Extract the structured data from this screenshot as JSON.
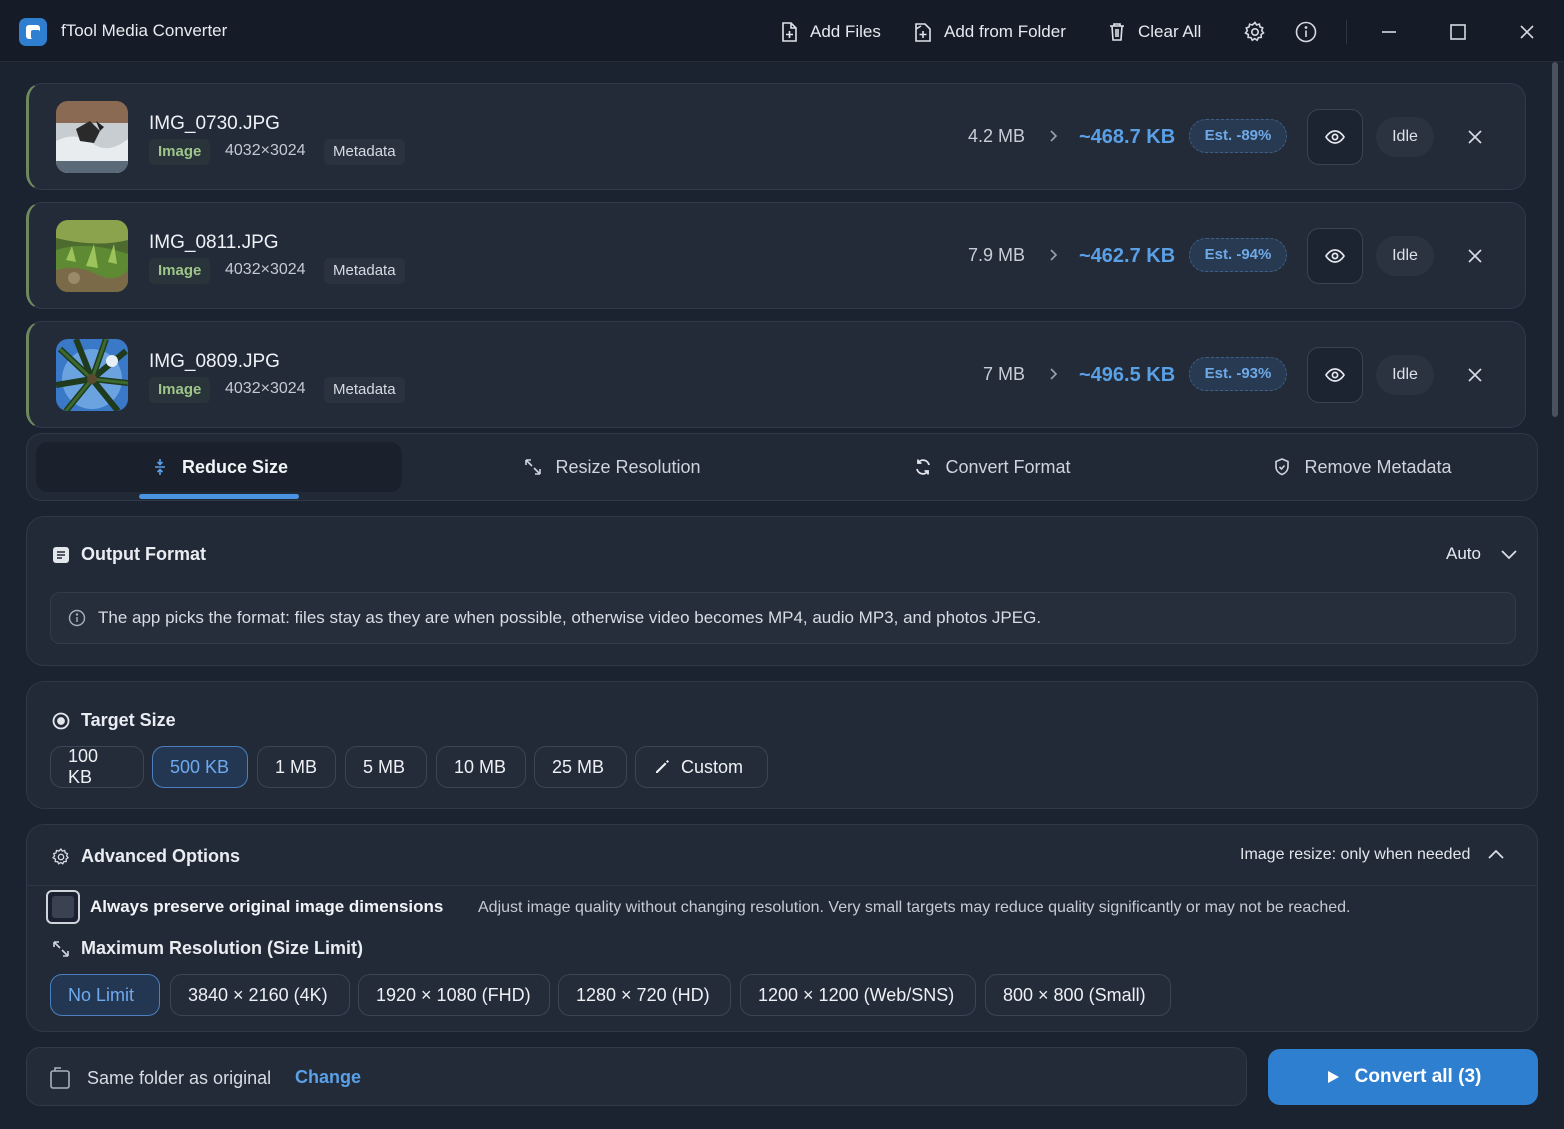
{
  "app": {
    "title": "fTool Media Converter"
  },
  "toolbar": {
    "add_files": "Add Files",
    "add_folder": "Add from Folder",
    "clear_all": "Clear All"
  },
  "files": [
    {
      "name": "IMG_0730.JPG",
      "type": "Image",
      "dims": "4032×3024",
      "meta": "Metadata",
      "orig": "4.2 MB",
      "new": "~468.7 KB",
      "est": "Est. -89%",
      "status": "Idle"
    },
    {
      "name": "IMG_0811.JPG",
      "type": "Image",
      "dims": "4032×3024",
      "meta": "Metadata",
      "orig": "7.9 MB",
      "new": "~462.7 KB",
      "est": "Est. -94%",
      "status": "Idle"
    },
    {
      "name": "IMG_0809.JPG",
      "type": "Image",
      "dims": "4032×3024",
      "meta": "Metadata",
      "orig": "7 MB",
      "new": "~496.5 KB",
      "est": "Est. -93%",
      "status": "Idle"
    }
  ],
  "tabs": [
    {
      "label": "Reduce Size",
      "active": true
    },
    {
      "label": "Resize Resolution",
      "active": false
    },
    {
      "label": "Convert Format",
      "active": false
    },
    {
      "label": "Remove Metadata",
      "active": false
    }
  ],
  "output_format": {
    "title": "Output Format",
    "value": "Auto",
    "info": "The app picks the format: files stay as they are when possible, otherwise video becomes MP4, audio MP3, and photos JPEG."
  },
  "target_size": {
    "title": "Target Size",
    "options": [
      "100 KB",
      "500 KB",
      "1 MB",
      "5 MB",
      "10 MB",
      "25 MB"
    ],
    "selected": "500 KB",
    "custom_label": "Custom"
  },
  "advanced": {
    "title": "Advanced Options",
    "summary": "Image resize: only when needed",
    "preserve_label": "Always preserve original image dimensions",
    "preserve_desc": "Adjust image quality without changing resolution. Very small targets may reduce quality significantly or may not be reached.",
    "preserve_checked": false,
    "max_res_title": "Maximum Resolution (Size Limit)",
    "resolutions": [
      "No Limit",
      "3840 × 2160 (4K)",
      "1920 × 1080 (FHD)",
      "1280 × 720 (HD)",
      "1200 × 1200 (Web/SNS)",
      "800 × 800 (Small)"
    ],
    "selected_resolution": "No Limit"
  },
  "destination": {
    "label": "Same folder as original",
    "change": "Change"
  },
  "convert": {
    "label": "Convert all (3)"
  },
  "colors": {
    "accent": "#2f7fd0",
    "link": "#5aa0e6",
    "image_tag": "#9fc58a",
    "background": "#1b2230"
  }
}
